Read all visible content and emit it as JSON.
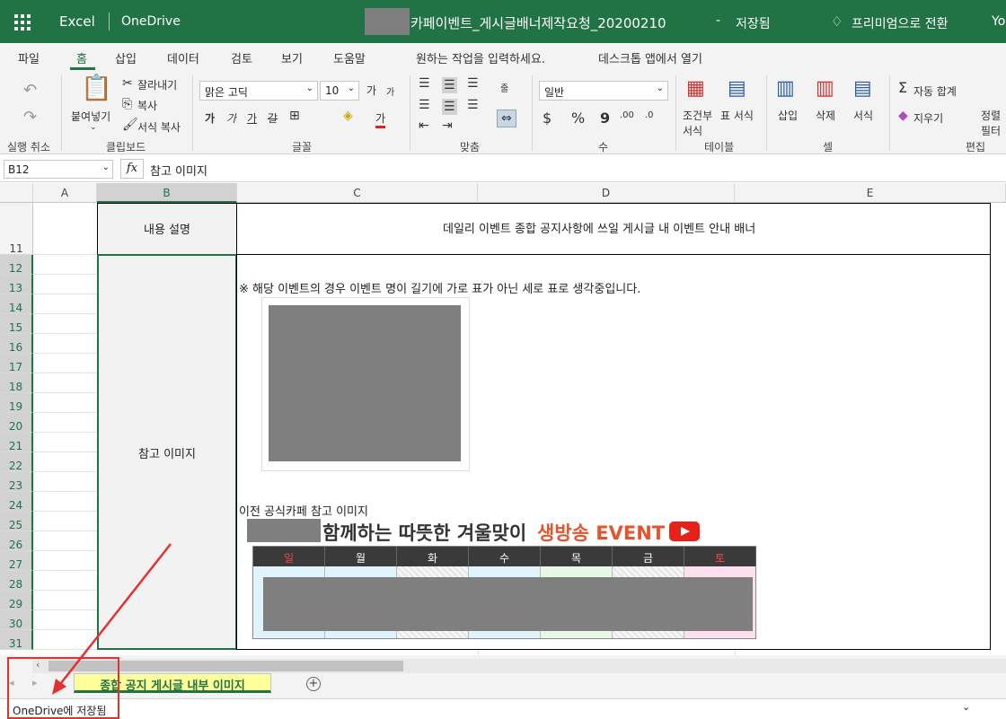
{
  "titlebar": {
    "app": "Excel",
    "location": "OneDrive",
    "document": "카페이벤트_게시글배너제작요청_20200210",
    "separator": "-",
    "save_status": "저장됨",
    "premium": "프리미엄으로 전환",
    "user": "Yo"
  },
  "tabs": [
    "파일",
    "홈",
    "삽입",
    "데이터",
    "검토",
    "보기",
    "도움말"
  ],
  "search_hint": "원하는 작업을 입력하세요.",
  "desktop_open": "데스크톱 앱에서 열기",
  "ribbon": {
    "undo_group": "실행 취소",
    "clipboard": {
      "paste": "붙여넣기",
      "cut": "잘라내기",
      "copy": "복사",
      "format_painter": "서식 복사",
      "group": "클립보드"
    },
    "font": {
      "name": "맑은 고딕",
      "size": "10",
      "grow": "가",
      "shrink": "가",
      "bold": "가",
      "italic": "가",
      "underline": "가",
      "strike": "갈",
      "group": "글꼴"
    },
    "alignment": {
      "wrap": "줄",
      "group": "맞춤"
    },
    "number": {
      "format": "일반",
      "currency": "$",
      "percent": "%",
      "comma": "9",
      "group": "수"
    },
    "tables": {
      "cond_format": "조건부 서식",
      "table_format": "표 서식",
      "group": "테이블"
    },
    "cells": {
      "insert": "삽입",
      "delete": "삭제",
      "format": "서식",
      "group": "셀"
    },
    "editing": {
      "autosum": "자동 합계",
      "clear": "지우기",
      "sort": "정렬 필터",
      "group": "편집"
    }
  },
  "formula": {
    "namebox": "B12",
    "fx": "fx",
    "value": "참고 이미지"
  },
  "columns": [
    "A",
    "B",
    "C",
    "D",
    "E"
  ],
  "rows": [
    "11",
    "12",
    "13",
    "14",
    "15",
    "16",
    "17",
    "18",
    "19",
    "20",
    "21",
    "22",
    "23",
    "24",
    "25",
    "26",
    "27",
    "28",
    "29",
    "30",
    "31"
  ],
  "cells": {
    "b11": "내용 설명",
    "c11": "데일리 이벤트 종합 공지사항에 쓰일 게시글 내 이벤트 안내 배너",
    "b12": "참고 이미지",
    "note": "※ 해당 이벤트의 경우 이벤트 명이 길기에 가로 표가 아닌 세로 표로 생각중입니다.",
    "prev_label": "이전 공식카페 참고 이미지"
  },
  "banner": {
    "title": "함께하는 따뜻한 겨울맞이",
    "highlight": "생방송 EVENT",
    "days": [
      "일",
      "월",
      "화",
      "수",
      "목",
      "금",
      "토"
    ]
  },
  "sheet": {
    "tab": "종합 공지 게시글 내부 이미지",
    "add": "+"
  },
  "status": {
    "text": "OneDrive에 저장됨"
  },
  "colors": {
    "brand": "#217346",
    "annotation": "#e53030"
  }
}
